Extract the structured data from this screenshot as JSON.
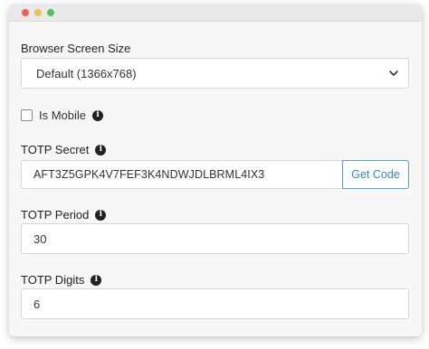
{
  "window": {
    "controls": [
      {
        "name": "close",
        "color": "#ee5f57"
      },
      {
        "name": "minimize",
        "color": "#f4bd4f"
      },
      {
        "name": "maximize",
        "color": "#5cc05e"
      }
    ]
  },
  "browser_screen_size": {
    "label": "Browser Screen Size",
    "selected": "Default (1366x768)"
  },
  "is_mobile": {
    "label": "Is Mobile",
    "checked": false,
    "info_icon": "info-icon"
  },
  "totp_secret": {
    "label": "TOTP Secret",
    "value": "AFT3Z5GPK4V7FEF3K4NDWJDLBRML4IX3",
    "button_label": "Get Code",
    "info_icon": "info-icon"
  },
  "totp_period": {
    "label": "TOTP Period",
    "value": "30",
    "info_icon": "info-icon"
  },
  "totp_digits": {
    "label": "TOTP Digits",
    "value": "6",
    "info_icon": "info-icon"
  },
  "colors": {
    "accent": "#3a82c4",
    "info_icon": "#222222"
  }
}
